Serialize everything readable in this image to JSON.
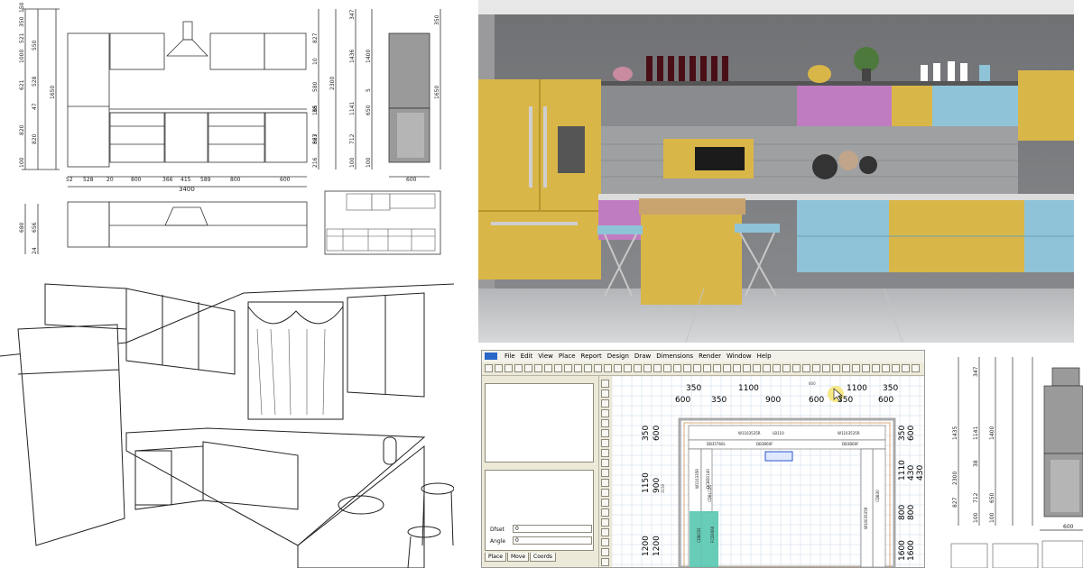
{
  "elevation": {
    "dims_left": [
      "150",
      "350",
      "521",
      "1000",
      "550",
      "621",
      "528",
      "47",
      "1650",
      "820",
      "820",
      "100"
    ],
    "dims_bottom": [
      "52",
      "528",
      "20",
      "800",
      "366",
      "415",
      "589",
      "800",
      "600"
    ],
    "total_width": "3400",
    "dims_right": [
      "827",
      "10",
      "580",
      "165",
      "38",
      "563",
      "827",
      "216",
      "2300",
      "347",
      "1436",
      "1400",
      "1141",
      "712",
      "650",
      "100",
      "100",
      "5"
    ],
    "plan_dims": [
      "680",
      "656",
      "24"
    ],
    "side_bottom": "600",
    "side_right": "350",
    "side_right_mid": "1650"
  },
  "cad": {
    "menu": [
      "File",
      "Edit",
      "View",
      "Place",
      "Report",
      "Design",
      "Draw",
      "Dimensions",
      "Render",
      "Window",
      "Help"
    ],
    "fields": [
      {
        "label": "Dfset",
        "value": "0"
      },
      {
        "label": "Angle",
        "value": "0"
      }
    ],
    "tabs": [
      "Place",
      "Move",
      "Coords"
    ],
    "top_dims": [
      "350",
      "1100",
      "1100",
      "350"
    ],
    "top_dims2": [
      "600",
      "350",
      "900",
      "600",
      "350",
      "600"
    ],
    "top_small": "600",
    "left_dims": [
      "350",
      "600",
      "1150",
      "900",
      "1200",
      "1200"
    ],
    "left_small": "3150",
    "right_dims": [
      "350",
      "600",
      "1110",
      "430",
      "430",
      "800",
      "800",
      "1600",
      "1600"
    ],
    "cabinet_labels": [
      "W1103535R",
      "LB110",
      "W1103535R",
      "DB35760L",
      "DB3B60F",
      "DB3B60F",
      "W110335R",
      "DCBD1140",
      "CDBLCD1",
      "CDBCD1",
      "FCD3060",
      "W1003535R",
      "CDB30"
    ]
  },
  "crop_dims": {
    "vertical": [
      "347",
      "1435",
      "1141",
      "1400",
      "2300",
      "38",
      "827",
      "712",
      "650",
      "100",
      "100"
    ],
    "bottom": "600"
  },
  "colors": {
    "cad_bg": "#ece9d8",
    "grid": "#c8d8e8",
    "teal_tile": "#58c8b0",
    "yellow": "#d9b648",
    "pink": "#c07cc0",
    "blue": "#8fc3d8",
    "wall_gray": "#7c7d80"
  }
}
